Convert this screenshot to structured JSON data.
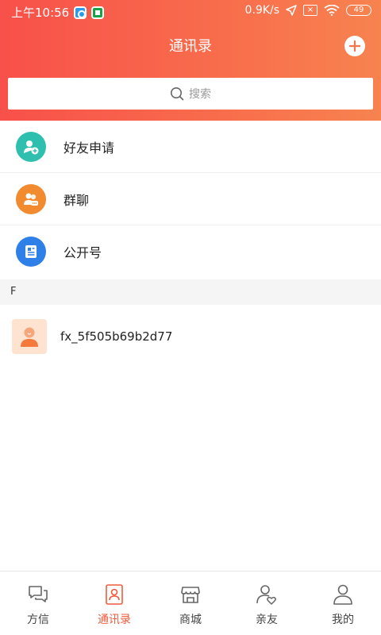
{
  "status_bar": {
    "time": "上午10:56",
    "speed": "0.9K/s",
    "battery": "49"
  },
  "header": {
    "title": "通讯录"
  },
  "search": {
    "placeholder": "搜索"
  },
  "menu": {
    "items": [
      {
        "label": "好友申请",
        "icon": "add-friend-icon",
        "color": "#2fbfae"
      },
      {
        "label": "群聊",
        "icon": "group-chat-icon",
        "color": "#f28a2f"
      },
      {
        "label": "公开号",
        "icon": "official-account-icon",
        "color": "#2f7fe8"
      }
    ]
  },
  "contacts": {
    "section": "F",
    "items": [
      {
        "name": "fx_5f505b69b2d77"
      }
    ]
  },
  "tabbar": {
    "active": 1,
    "accent": "#f15a3c",
    "items": [
      {
        "label": "方信",
        "icon": "chat-bubbles-icon"
      },
      {
        "label": "通讯录",
        "icon": "contacts-icon"
      },
      {
        "label": "商城",
        "icon": "store-icon"
      },
      {
        "label": "亲友",
        "icon": "friends-heart-icon"
      },
      {
        "label": "我的",
        "icon": "profile-icon"
      }
    ]
  }
}
